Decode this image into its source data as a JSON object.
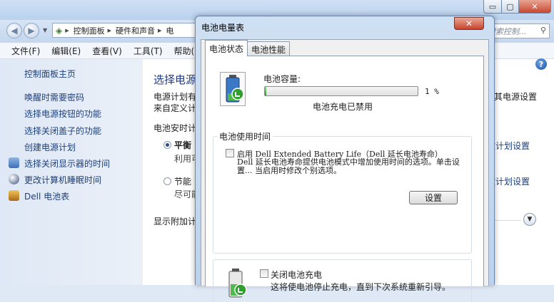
{
  "control_panel": {
    "window_buttons": {
      "minimize": "▭",
      "maximize": "▢",
      "close": "✕"
    },
    "breadcrumbs": [
      "控制面板",
      "硬件和声音",
      "电"
    ],
    "search_placeholder": "搜索控制...",
    "menu": [
      "文件(F)",
      "编辑(E)",
      "查看(V)",
      "工具(T)",
      "帮助(H)"
    ],
    "sidebar": {
      "home": "控制面板主页",
      "links": [
        "唤醒时需要密码",
        "选择电源按钮的功能",
        "选择关闭盖子的功能",
        "创建电源计划"
      ],
      "icon_links": [
        {
          "label": "选择关闭显示器的时间",
          "icon": "display-icon"
        },
        {
          "label": "更改计算机睡眠时间",
          "icon": "moon-icon"
        },
        {
          "label": "Dell 电池表",
          "icon": "battery-meter-icon"
        }
      ]
    },
    "main": {
      "heading": "选择电源",
      "desc_line1": "电源计划有",
      "desc_line2": "来自定义计",
      "right_desc": "改其电源设置",
      "plan_prompt": "电池安时计",
      "plan1_name": "平衡",
      "plan1_desc": "利用可",
      "plan1_link": "改计划设置",
      "plan2_name": "节能",
      "plan2_desc": "尽可能",
      "plan2_link": "改计划设置",
      "more_plans": "显示附加计"
    }
  },
  "dialog": {
    "title": "电池电量表",
    "close": "✕",
    "tabs": [
      "电池状态",
      "电池性能"
    ],
    "capacity_label": "电池容量:",
    "capacity_percent": 1,
    "capacity_text": "1 %",
    "charge_status": "电池充电已禁用",
    "usage_group_title": "电池使用时间",
    "ebl_label": "启用 Dell Extended Battery Life（Dell 延长电池寿命）",
    "ebl_desc": "Dell 延长电池寿命提供电池模式中增加使用时间的选项。单击设置... 当启用时修改个别选项。",
    "settings_button": "设置",
    "disable_charge_label": "关闭电池充电",
    "disable_charge_desc": "这将使电池停止充电，直到下次系统重新引导。"
  }
}
